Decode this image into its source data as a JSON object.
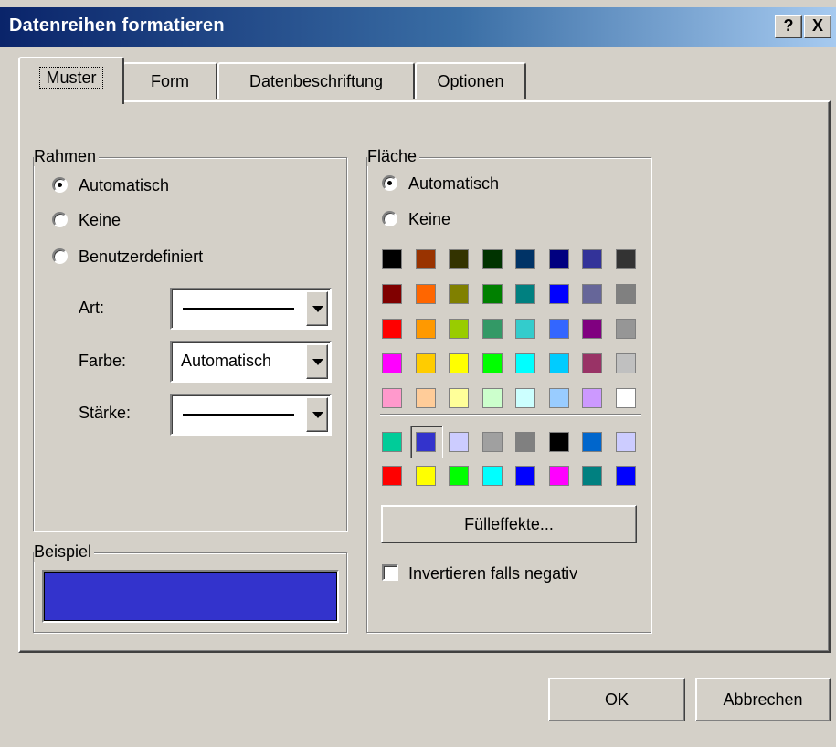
{
  "window": {
    "title": "Datenreihen formatieren",
    "help_label": "?",
    "close_label": "X"
  },
  "tabs": [
    {
      "label": "Muster",
      "active": true
    },
    {
      "label": "Form",
      "active": false
    },
    {
      "label": "Datenbeschriftung",
      "active": false
    },
    {
      "label": "Optionen",
      "active": false
    }
  ],
  "rahmen": {
    "legend": "Rahmen",
    "options": [
      {
        "label": "Automatisch",
        "checked": true
      },
      {
        "label": "Keine",
        "checked": false
      },
      {
        "label": "Benutzerdefiniert",
        "checked": false
      }
    ],
    "art_label": "Art:",
    "farbe_label": "Farbe:",
    "farbe_value": "Automatisch",
    "staerke_label": "Stärke:"
  },
  "beispiel": {
    "legend": "Beispiel",
    "color": "#3333cc"
  },
  "flaeche": {
    "legend": "Fläche",
    "options": [
      {
        "label": "Automatisch",
        "checked": true
      },
      {
        "label": "Keine",
        "checked": false
      }
    ],
    "palette_main": [
      [
        "#000000",
        "#993300",
        "#333300",
        "#003300",
        "#003366",
        "#000080",
        "#333399",
        "#333333"
      ],
      [
        "#800000",
        "#ff6600",
        "#808000",
        "#008000",
        "#008080",
        "#0000ff",
        "#666699",
        "#808080"
      ],
      [
        "#ff0000",
        "#ff9900",
        "#99cc00",
        "#339966",
        "#33cccc",
        "#3366ff",
        "#800080",
        "#969696"
      ],
      [
        "#ff00ff",
        "#ffcc00",
        "#ffff00",
        "#00ff00",
        "#00ffff",
        "#00ccff",
        "#993366",
        "#c0c0c0"
      ],
      [
        "#ff99cc",
        "#ffcc99",
        "#ffff99",
        "#ccffcc",
        "#ccffff",
        "#99ccff",
        "#cc99ff",
        "#ffffff"
      ]
    ],
    "palette_chart": [
      [
        "#00cc99",
        "#3333cc",
        "#ccccff",
        "#a0a0a0",
        "#808080",
        "#000000",
        "#0066cc",
        "#ccccff"
      ],
      [
        "#ff0000",
        "#ffff00",
        "#00ff00",
        "#00ffff",
        "#0000ff",
        "#ff00ff",
        "#008080",
        "#0000ff"
      ]
    ],
    "selected_swatch": "#3333cc",
    "fill_effects_label": "Fülleffekte...",
    "invert_label": "Invertieren falls negativ",
    "invert_checked": false
  },
  "footer": {
    "ok_label": "OK",
    "cancel_label": "Abbrechen"
  }
}
